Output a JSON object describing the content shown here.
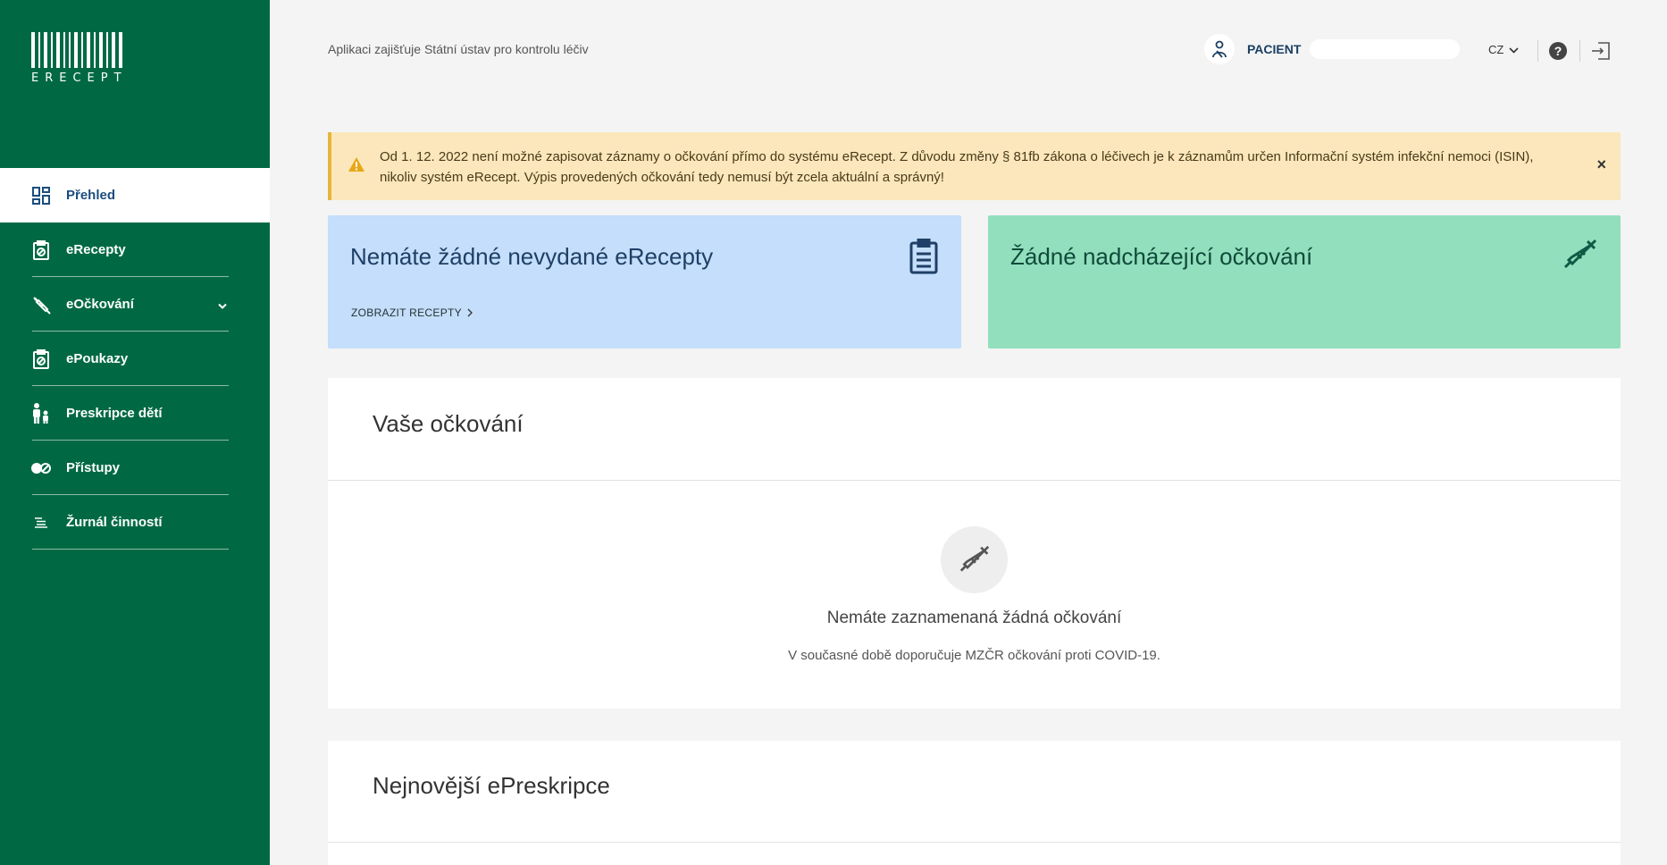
{
  "brand": {
    "logo_text": "ERECEPT"
  },
  "sidebar": {
    "items": [
      {
        "label": "Přehled",
        "icon": "dashboard-icon",
        "active": true
      },
      {
        "label": "eRecepty",
        "icon": "clipboard-icon"
      },
      {
        "label": "eOčkování",
        "icon": "syringe-icon",
        "has_submenu": true
      },
      {
        "label": "ePoukazy",
        "icon": "clipboard-icon"
      },
      {
        "label": "Preskripce dětí",
        "icon": "family-icon"
      },
      {
        "label": "Přístupy",
        "icon": "pills-icon"
      },
      {
        "label": "Žurnál činností",
        "icon": "list-icon"
      }
    ]
  },
  "header": {
    "note": "Aplikaci zajišťuje Státní ústav pro kontrolu léčiv",
    "user_role": "PACIENT",
    "language": "CZ",
    "help_label": "?"
  },
  "alert": {
    "text": "Od 1. 12. 2022 není možné zapisovat záznamy o očkování přímo do systému eRecept. Z důvodu změny § 81fb zákona o léčivech je k záznamům určen Informační systém infekční nemoci (ISIN), nikoliv systém eRecept. Výpis provedených očkování tedy nemusí být zcela aktuální a správný!",
    "close_label": "×"
  },
  "cards": {
    "prescriptions": {
      "title": "Nemáte žádné nevydané eRecepty",
      "link_label": "ZOBRAZIT RECEPTY"
    },
    "vaccinations": {
      "title": "Žádné nadcházející očkování"
    }
  },
  "vaccination_panel": {
    "title": "Vaše očkování",
    "empty_title": "Nemáte zaznamenaná žádná očkování",
    "empty_subtitle": "V současné době doporučuje MZČR očkování proti COVID-19."
  },
  "prescription_panel": {
    "title": "Nejnovější ePreskripce"
  },
  "colors": {
    "sidebar": "#006944",
    "alert_bg": "#fbe7bb",
    "card_blue": "#c4defb",
    "card_green": "#92dfbe"
  }
}
